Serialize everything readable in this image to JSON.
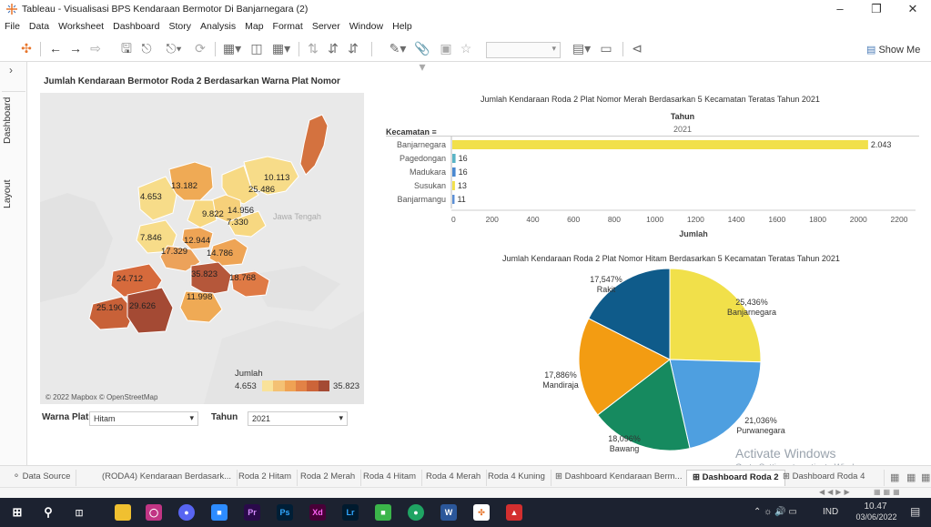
{
  "window": {
    "title": "Tableau - Visualisasi BPS Kendaraan Bermotor Di Banjarnegara (2)"
  },
  "menu": [
    "File",
    "Data",
    "Worksheet",
    "Dashboard",
    "Story",
    "Analysis",
    "Map",
    "Format",
    "Server",
    "Window",
    "Help"
  ],
  "toolbar": {
    "show_me": "Show Me"
  },
  "sidebar": {
    "dashboard_tab": "Dashboard",
    "layout_tab": "Layout"
  },
  "map": {
    "title": "Jumlah Kendaraan Bermotor Roda 2 Berdasarkan Warna Plat Nomor",
    "attribution": "© 2022 Mapbox © OpenStreetMap",
    "region_label": "Jawa Tengah",
    "legend_title": "Jumlah",
    "legend_min": "4.653",
    "legend_max": "35.823",
    "labels": [
      "10.113",
      "13.182",
      "25.486",
      "4.653",
      "14.956",
      "9.822",
      "7.330",
      "7.846",
      "12.944",
      "17.329",
      "14.786",
      "35.823",
      "18.768",
      "24.712",
      "11.998",
      "25.190",
      "29.626"
    ]
  },
  "filters": {
    "warna_label": "Warna Plat",
    "warna_value": "Hitam",
    "tahun_label": "Tahun",
    "tahun_value": "2021"
  },
  "bar_chart": {
    "title": "Jumlah Kendaraan Roda 2 Plat Nomor Merah Berdasarkan 5 Kecamatan Teratas Tahun 2021",
    "column_header": "Tahun",
    "column_value": "2021",
    "row_header": "Kecamatan"
  },
  "pie_chart": {
    "title": "Jumlah Kendaraan Roda 2 Plat Nomor Hitam Berdasarkan 5 Kecamatan Teratas Tahun 2021"
  },
  "chart_data": [
    {
      "type": "bar",
      "categories": [
        "Banjarnegara",
        "Pagedongan",
        "Madukara",
        "Susukan",
        "Banjarmangu"
      ],
      "values": [
        2043,
        16,
        16,
        13,
        11
      ],
      "value_labels": [
        "2.043",
        "16",
        "16",
        "13",
        "11"
      ],
      "colors": [
        "#f1e04a",
        "#5ab4c6",
        "#4a88d0",
        "#f1e04a",
        "#5b8fd6"
      ],
      "xlabel": "Jumlah",
      "ticks": [
        0,
        200,
        400,
        600,
        800,
        1000,
        1200,
        1400,
        1600,
        1800,
        2000,
        2200
      ],
      "xlim": [
        0,
        2200
      ]
    },
    {
      "type": "pie",
      "slices": [
        {
          "name": "Banjarnegara",
          "value": 25.436,
          "label": "25,436%",
          "color": "#f1e04a"
        },
        {
          "name": "Purwanegara",
          "value": 21.036,
          "label": "21,036%",
          "color": "#4e9fe0"
        },
        {
          "name": "Bawang",
          "value": 18.096,
          "label": "18,096%",
          "color": "#168a5f"
        },
        {
          "name": "Mandiraja",
          "value": 17.886,
          "label": "17,886%",
          "color": "#f39c12"
        },
        {
          "name": "Rakit",
          "value": 17.547,
          "label": "17,547%",
          "color": "#0f5b8a"
        }
      ]
    }
  ],
  "tabs": [
    "Data Source",
    "(RODA4) Kendaraan Berdasark...",
    "Roda 2 Hitam",
    "Roda 2 Merah",
    "Roda 4 Hitam",
    "Roda 4 Merah",
    "Roda 4 Kuning",
    "Dashboard Kendaraan Berm...",
    "Dashboard Roda 2",
    "Dashboard Roda 4"
  ],
  "watermark": {
    "line1": "Activate Windows",
    "line2": "Go to Settings to activate Windows."
  },
  "taskbar": {
    "time": "10.47",
    "date": "03/06/2022",
    "lang": "IND"
  }
}
